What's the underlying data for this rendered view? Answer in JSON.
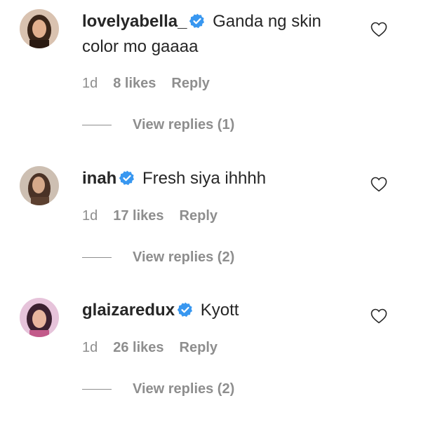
{
  "comments": [
    {
      "username": "lovelyabella_",
      "text": "Ganda ng skin color mo gaaaa",
      "age": "1d",
      "likes": "8 likes",
      "reply_label": "Reply",
      "view_replies": "View replies (1)",
      "avatar_color": "#6b4a3a"
    },
    {
      "username": "inah",
      "text": "Fresh siya ihhhh",
      "age": "1d",
      "likes": "17 likes",
      "reply_label": "Reply",
      "view_replies": "View replies (2)",
      "avatar_color": "#8a6a55"
    },
    {
      "username": "glaizaredux",
      "text": "Kyott",
      "age": "1d",
      "likes": "26 likes",
      "reply_label": "Reply",
      "view_replies": "View replies (2)",
      "avatar_color": "#c25a8a"
    }
  ],
  "colors": {
    "verified_blue": "#3897f0",
    "meta_gray": "#8e8e8e",
    "text_dark": "#262626"
  },
  "icons": {
    "verified": "verified-badge-icon",
    "like": "heart-outline-icon"
  }
}
